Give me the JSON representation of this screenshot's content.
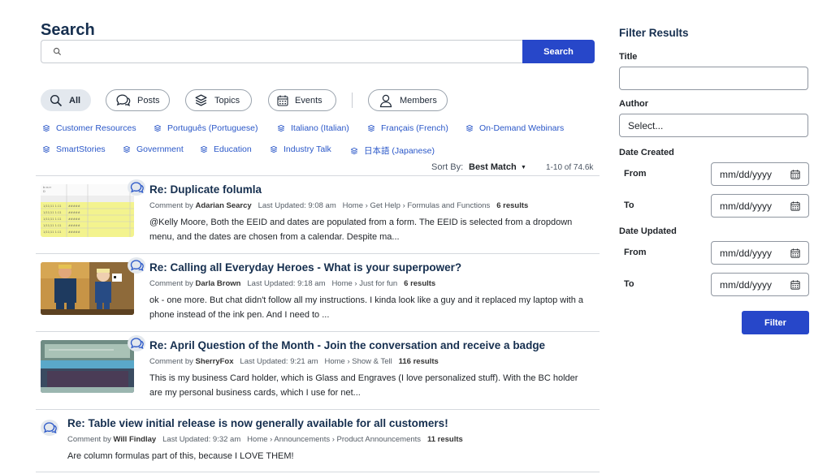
{
  "search": {
    "title": "Search",
    "value": "",
    "button_label": "Search"
  },
  "tabs": [
    {
      "label": "All",
      "icon": "search-icon",
      "active": true
    },
    {
      "label": "Posts",
      "icon": "chat-bubbles-icon"
    },
    {
      "label": "Topics",
      "icon": "stack-icon"
    },
    {
      "label": "Events",
      "icon": "calendar-icon"
    },
    {
      "label": "Members",
      "icon": "person-icon"
    }
  ],
  "categories": [
    "Customer Resources",
    "Português (Portuguese)",
    "Italiano (Italian)",
    "Français (French)",
    "On-Demand Webinars",
    "SmartStories",
    "Government",
    "Education",
    "Industry Talk",
    "日本語 (Japanese)"
  ],
  "sort": {
    "label": "Sort By:",
    "value": "Best Match",
    "count": "1-10 of 74.6k"
  },
  "results": [
    {
      "title": "Re: Duplicate folumla",
      "type": "Comment by",
      "author": "Adarian Searcy",
      "updated": "Last Updated: 9:08 am",
      "breadcrumb": "Home › Get Help › Formulas and Functions",
      "count": "6 results",
      "excerpt": "@Kelly Moore, Both the EEID and dates are populated from a form. The EEID is selected from a dropdown menu, and the dates are chosen from a calendar. Despite ma...",
      "thumbnail": "spreadsheet"
    },
    {
      "title": "Re: Calling all Everyday Heroes - What is your superpower?",
      "type": "Comment by",
      "author": "Darla Brown",
      "updated": "Last Updated: 9:18 am",
      "breadcrumb": "Home › Just for fun",
      "count": "6 results",
      "excerpt": "ok - one more. But chat didn't follow all my instructions. I kinda look like a guy and it replaced my laptop with a phone instead of the ink pen. And I need to ...",
      "thumbnail": "cartoon"
    },
    {
      "title": "Re: April Question of the Month - Join the conversation and receive a badge",
      "type": "Comment by",
      "author": "SherryFox",
      "updated": "Last Updated: 9:21 am",
      "breadcrumb": "Home › Show & Tell",
      "count": "116 results",
      "excerpt": "This is my business Card holder, which is Glass and Engraves (I love personalized stuff). With the BC holder are my personal business cards, which I use for net...",
      "thumbnail": "glass"
    },
    {
      "title": "Re: Table view initial release is now generally available for all customers!",
      "type": "Comment by",
      "author": "Will Findlay",
      "updated": "Last Updated: 9:32 am",
      "breadcrumb": "Home › Announcements › Product Announcements",
      "count": "11 results",
      "excerpt": "Are column formulas part of this, because I LOVE THEM!",
      "thumbnail": ""
    }
  ],
  "filters": {
    "title": "Filter Results",
    "title_label": "Title",
    "title_value": "",
    "author_label": "Author",
    "author_placeholder": "Select...",
    "date_created_label": "Date Created",
    "date_updated_label": "Date Updated",
    "from_label": "From",
    "to_label": "To",
    "date_placeholder": "mm/dd/yyyy",
    "button_label": "Filter"
  },
  "colors": {
    "accent": "#2747c9",
    "heading": "#162f4f",
    "link": "#2a57c8"
  }
}
